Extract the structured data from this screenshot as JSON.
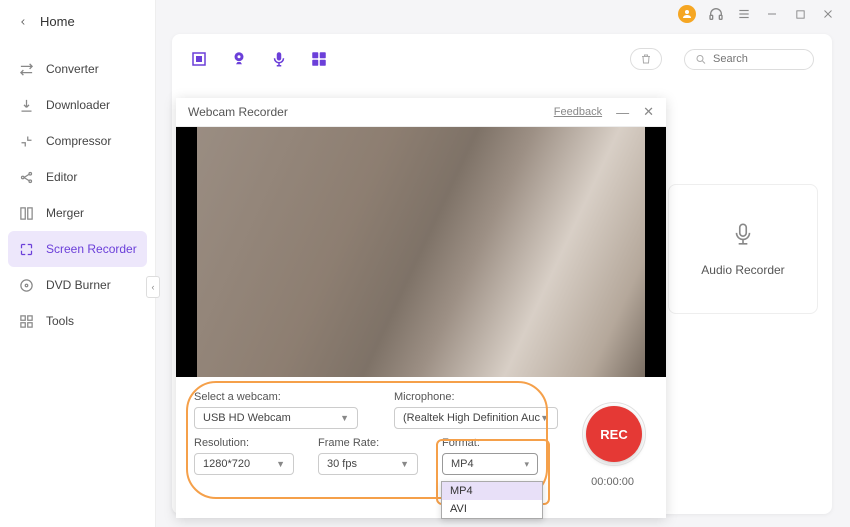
{
  "titlebar": {},
  "sidebar": {
    "home": "Home",
    "items": [
      {
        "label": "Converter"
      },
      {
        "label": "Downloader"
      },
      {
        "label": "Compressor"
      },
      {
        "label": "Editor"
      },
      {
        "label": "Merger"
      },
      {
        "label": "Screen Recorder"
      },
      {
        "label": "DVD Burner"
      },
      {
        "label": "Tools"
      }
    ]
  },
  "toolbar": {
    "search_placeholder": "Search"
  },
  "audio_card": {
    "label": "Audio Recorder"
  },
  "modal": {
    "title": "Webcam Recorder",
    "feedback": "Feedback"
  },
  "controls": {
    "webcam_label": "Select a webcam:",
    "webcam_value": "USB HD Webcam",
    "mic_label": "Microphone:",
    "mic_value": "(Realtek High Definition Auc",
    "res_label": "Resolution:",
    "res_value": "1280*720",
    "fps_label": "Frame Rate:",
    "fps_value": "30 fps",
    "format_label": "Format:",
    "format_value": "MP4",
    "rec_label": "REC",
    "timer": "00:00:00",
    "format_options": [
      "MP4",
      "AVI"
    ]
  }
}
